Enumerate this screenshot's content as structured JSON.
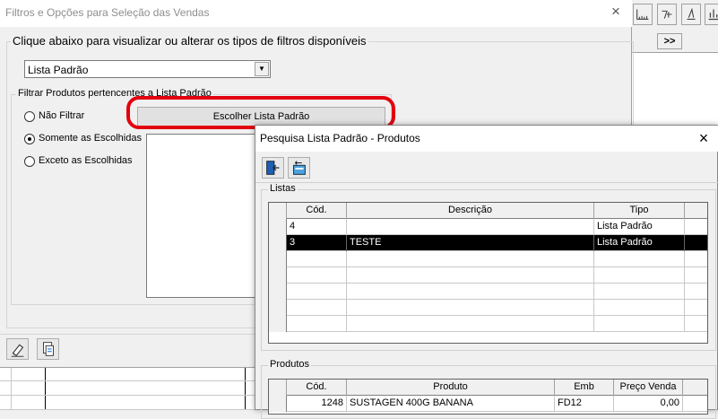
{
  "background": {
    "toolbar": {
      "icons": [
        "ruler-icon",
        "star-icon",
        "pencil-triangle-icon",
        "chart-icon"
      ]
    },
    "nav_button_label": ">>"
  },
  "filter_dialog": {
    "title": "Filtros e Opções para Seleção das Vendas",
    "close_glyph": "×",
    "instruction": "Clique abaixo para visualizar ou alterar os tipos de filtros disponíveis",
    "filter_type": {
      "selected": "Lista Padrão",
      "arrow": "▼"
    },
    "group_title": "Filtrar Produtos pertencentes a Lista Padrão",
    "radios": [
      {
        "label": "Não Filtrar",
        "selected": false
      },
      {
        "label": "Somente as Escolhidas",
        "selected": true
      },
      {
        "label": "Exceto as Escolhidas",
        "selected": false
      }
    ],
    "choose_button": "Escolher Lista Padrão",
    "annotation_color": "#e3000f",
    "footer_icons": [
      "eraser-icon",
      "copy-document-icon"
    ]
  },
  "search_dialog": {
    "title": "Pesquisa Lista Padrão - Produtos",
    "close_glyph": "×",
    "toolbar_icons": [
      "exit-door-icon",
      "return-card-icon"
    ],
    "lists_group": {
      "title": "Listas",
      "columns": [
        "Cód.",
        "Descrição",
        "Tipo"
      ],
      "rows": [
        {
          "cod": "4",
          "descricao": "",
          "tipo": "Lista Padrão",
          "selected": false
        },
        {
          "cod": "3",
          "descricao": "TESTE",
          "tipo": "Lista Padrão",
          "selected": true
        }
      ]
    },
    "products_group": {
      "title": "Produtos",
      "columns": [
        "Cód.",
        "Produto",
        "Emb",
        "Preço Venda"
      ],
      "rows": [
        {
          "cod": "1248",
          "produto": "SUSTAGEN 400G BANANA",
          "emb": "FD12",
          "preco": "0,00"
        }
      ]
    }
  }
}
